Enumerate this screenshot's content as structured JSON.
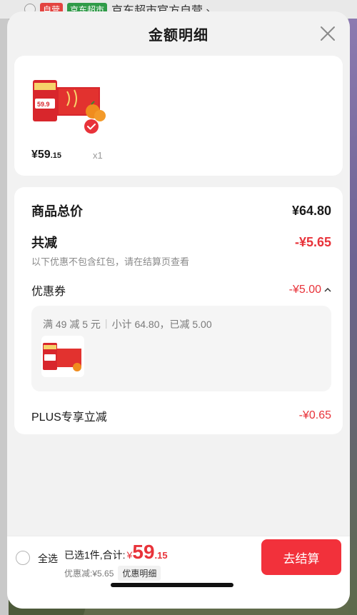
{
  "backdrop": {
    "tag_self_operated": "自营",
    "tag_store_type": "京东超市",
    "store_name": "京东超市官方自营 ›"
  },
  "sheet": {
    "title": "金额明细"
  },
  "product": {
    "price_main": "¥59",
    "price_cents": ".15",
    "quantity": "x1",
    "selected": true
  },
  "details": {
    "total_label": "商品总价",
    "total_value": "¥64.80",
    "reduction_label": "共减",
    "reduction_value": "-¥5.65",
    "reduction_note": "以下优惠不包含红包，请在结算页查看",
    "coupon_label": "优惠券",
    "coupon_value": "-¥5.00",
    "coupon_rule": "满 49 减 5 元",
    "coupon_subtotal": "小计 64.80，已减 5.00",
    "plus_label": "PLUS专享立减",
    "plus_value": "-¥0.65"
  },
  "bottom": {
    "select_all": "全选",
    "selected_summary": "已选1件,合计:",
    "currency": "¥",
    "total_main": "59",
    "total_cents": ".15",
    "discount_text": "优惠减:¥5.65",
    "detail_button": "优惠明细",
    "checkout_button": "去结算"
  },
  "colors": {
    "accent_red": "#e8333a",
    "button_red": "#f2313b"
  }
}
